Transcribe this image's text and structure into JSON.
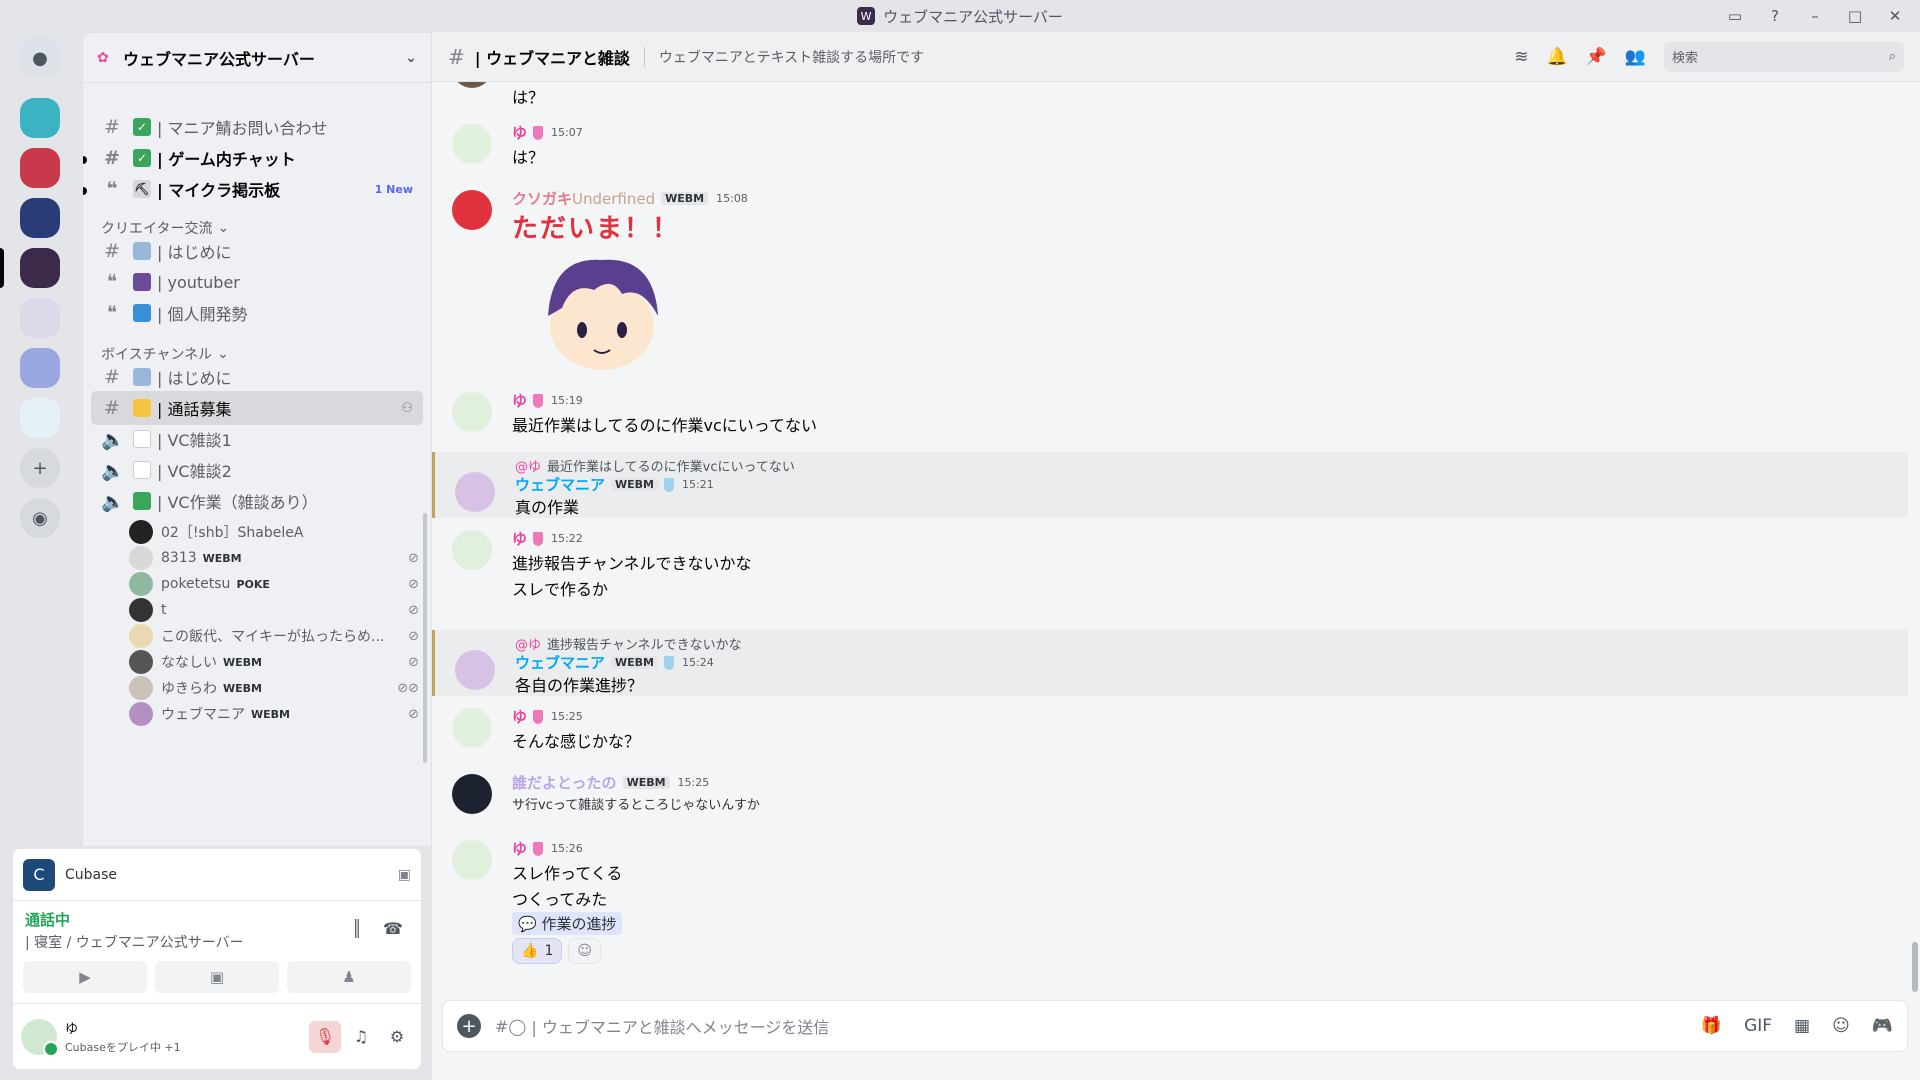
{
  "window": {
    "title": "ウェブマニア公式サーバー"
  },
  "server": {
    "name": "ウェブマニア公式サーバー"
  },
  "channels": {
    "top": [
      {
        "label": "| マニア鯖お問い合わせ"
      },
      {
        "label": "| ゲーム内チャット"
      },
      {
        "label": "| マイクラ掲示板",
        "badge": "1 New"
      }
    ],
    "cat1": "クリエイター交流",
    "creator": [
      {
        "label": "| はじめに"
      },
      {
        "label": "| youtuber"
      },
      {
        "label": "| 個人開発勢"
      }
    ],
    "cat2": "ボイスチャンネル",
    "voice": [
      {
        "label": "| はじめに"
      },
      {
        "label": "| 通話募集"
      },
      {
        "label": "| VC雑談1"
      },
      {
        "label": "| VC雑談2"
      },
      {
        "label": "| VC作業（雑談あり）"
      }
    ]
  },
  "voice_users": [
    {
      "name": "02［!shb］ShabeleA",
      "tag": ""
    },
    {
      "name": "8313",
      "tag": "WEBM"
    },
    {
      "name": "poketetsu",
      "tag": "POKE"
    },
    {
      "name": "t",
      "tag": ""
    },
    {
      "name": "この飯代、マイキーが払ったらめ...",
      "tag": ""
    },
    {
      "name": "ななしい",
      "tag": "WEBM"
    },
    {
      "name": "ゆきらわ",
      "tag": "WEBM"
    },
    {
      "name": "ウェブマニア",
      "tag": "WEBM"
    }
  ],
  "activity": {
    "app": "Cubase"
  },
  "voice_status": {
    "state": "通話中",
    "channel": "| 寝室 / ウェブマニア公式サーバー"
  },
  "user": {
    "name": "ゆ",
    "status": "Cubaseをプレイ中 +1"
  },
  "header": {
    "channel": "| ウェブマニアと雑談",
    "topic": "ウェブマニアとテキスト雑談する場所です",
    "search_placeholder": "検索"
  },
  "messages": [
    {
      "author": "",
      "time": "",
      "text": "は？"
    },
    {
      "author": "ゆ",
      "time": "15:07",
      "text": "は？"
    },
    {
      "author": "クソガキ",
      "author2": "Underfined",
      "tag": "WEBM",
      "time": "15:08",
      "sticker_text": "ただいま！！"
    },
    {
      "author": "ゆ",
      "time": "15:19",
      "text": "最近作業はしてるのに作業vcにいってない"
    },
    {
      "reply_name": "@ゆ",
      "reply_text": "最近作業はしてるのに作業vcにいってない",
      "author": "ウェブマニア",
      "tag": "WEBM",
      "time": "15:21",
      "text": "真の作業"
    },
    {
      "author": "ゆ",
      "time": "15:22",
      "text": "進捗報告チャンネルできないかな",
      "text2": "スレで作るか"
    },
    {
      "reply_name": "@ゆ",
      "reply_text": "進捗報告チャンネルできないかな",
      "author": "ウェブマニア",
      "tag": "WEBM",
      "time": "15:24",
      "text": "各自の作業進捗？"
    },
    {
      "author": "ゆ",
      "time": "15:25",
      "text": "そんな感じかな？"
    },
    {
      "author": "誰だよとったの",
      "tag": "WEBM",
      "time": "15:25",
      "text": "サ行vcって雑談するところじゃないんすか"
    },
    {
      "author": "ゆ",
      "time": "15:26",
      "text": "スレ作ってくる",
      "text2": "つくってみた",
      "thread": "作業の進捗",
      "reaction": "1"
    }
  ],
  "composer": {
    "placeholder": "| ウェブマニアと雑談へメッセージを送信"
  }
}
